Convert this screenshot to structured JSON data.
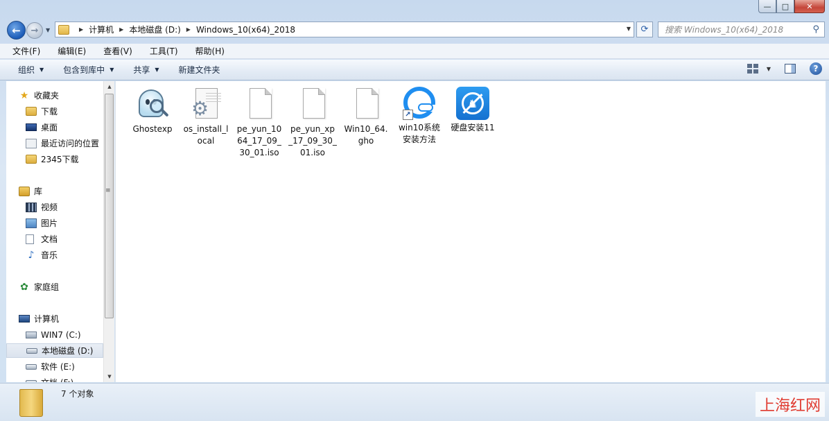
{
  "window": {
    "caption_buttons": [
      "—",
      "□",
      "✕"
    ]
  },
  "address": {
    "breadcrumbs": [
      "计算机",
      "本地磁盘 (D:)",
      "Windows_10(x64)_2018"
    ],
    "search_placeholder": "搜索 Windows_10(x64)_2018"
  },
  "menu": [
    "文件(F)",
    "编辑(E)",
    "查看(V)",
    "工具(T)",
    "帮助(H)"
  ],
  "commands": [
    "组织",
    "包含到库中",
    "共享",
    "新建文件夹"
  ],
  "nav": {
    "favorites": {
      "label": "收藏夹",
      "items": [
        "下载",
        "桌面",
        "最近访问的位置",
        "2345下载"
      ]
    },
    "libraries": {
      "label": "库",
      "items": [
        "视频",
        "图片",
        "文档",
        "音乐"
      ]
    },
    "homegroup": {
      "label": "家庭组"
    },
    "computer": {
      "label": "计算机",
      "items": [
        "WIN7 (C:)",
        "本地磁盘 (D:)",
        "软件 (E:)",
        "文档 (F:)"
      ]
    },
    "selected": "本地磁盘 (D:)"
  },
  "files": [
    {
      "name": "Ghostexp",
      "line1": "Ghostexp",
      "line2": "",
      "line3": "",
      "icon": "ghost-icon"
    },
    {
      "name": "os_install_local",
      "line1": "os_install_l",
      "line2": "ocal",
      "line3": "",
      "icon": "setup-config-icon"
    },
    {
      "name": "pe_yun_1064_17_09_30_01.iso",
      "line1": "pe_yun_10",
      "line2": "64_17_09_",
      "line3": "30_01.iso",
      "icon": "blank-file-icon"
    },
    {
      "name": "pe_yun_xp_17_09_30_01.iso",
      "line1": "pe_yun_xp",
      "line2": "_17_09_30_",
      "line3": "01.iso",
      "icon": "blank-file-icon"
    },
    {
      "name": "Win10_64.gho",
      "line1": "Win10_64.",
      "line2": "gho",
      "line3": "",
      "icon": "blank-file-icon"
    },
    {
      "name": "win10系统安装方法",
      "line1": "win10系统",
      "line2": "安装方法",
      "line3": "",
      "icon": "shortcut-app-icon"
    },
    {
      "name": "硬盘安装11",
      "line1": "硬盘安装11",
      "line2": "",
      "line3": "",
      "icon": "hard-disk-installer-icon"
    }
  ],
  "status": {
    "count_text": "7 个对象"
  },
  "watermark": "上海红网",
  "colors": {
    "accent": "#1f8ef0",
    "watermark": "#e03a2f"
  }
}
